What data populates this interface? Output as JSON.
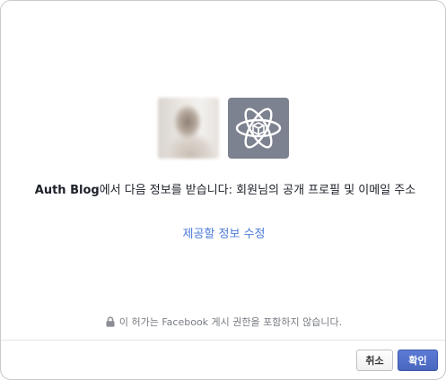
{
  "dialog": {
    "app_name": "Auth Blog",
    "message_rest": "에서 다음 정보를 받습니다: 회원님의 공개 프로필 및 이메일 주소",
    "edit_link": "제공할 정보 수정",
    "notice": "이 허가는 Facebook 게시 권한을 포함하지 않습니다.",
    "icons": {
      "user": "user-avatar-photo",
      "app": "atom-icon",
      "notice": "lock-icon"
    }
  },
  "buttons": {
    "cancel": "취소",
    "confirm": "확인"
  },
  "colors": {
    "link": "#4a7ad8",
    "primary_button": "#4a67be",
    "app_icon_bg": "#7d8290"
  }
}
